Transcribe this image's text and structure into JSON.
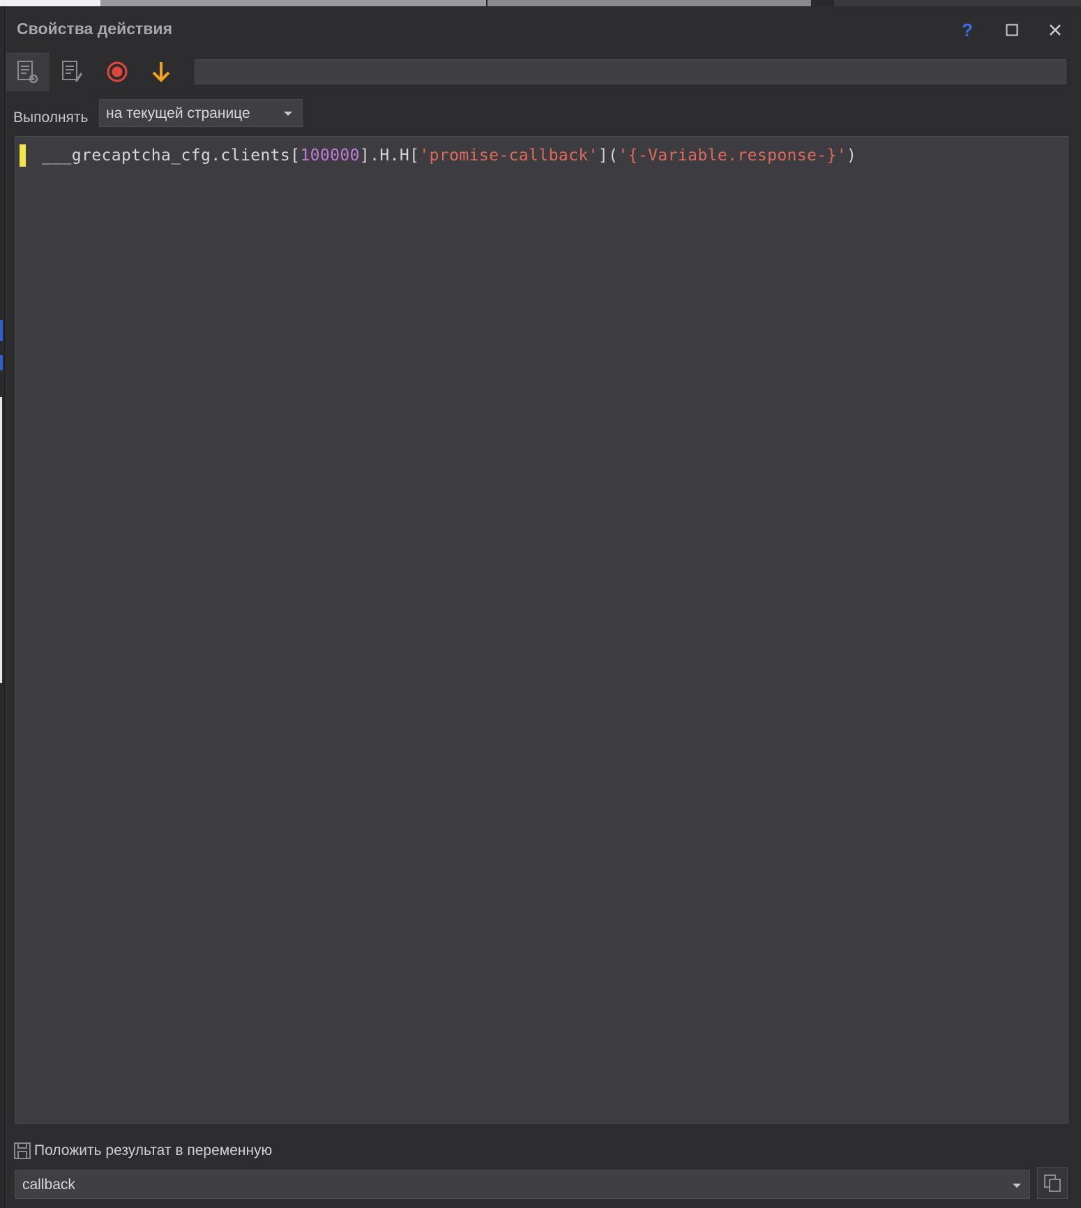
{
  "window": {
    "title": "Свойства действия"
  },
  "toolbar": {
    "buttons": [
      {
        "icon": "list-gear-icon",
        "active": true
      },
      {
        "icon": "list-edit-icon",
        "active": false
      },
      {
        "icon": "record-icon",
        "color": "#e0473c"
      },
      {
        "icon": "arrow-down-icon",
        "color": "#f2a316"
      }
    ],
    "input_value": ""
  },
  "execute": {
    "label": "Выполнять",
    "selected": "на текущей странице"
  },
  "editor": {
    "code_tokens": [
      {
        "type": "plain",
        "text": "___grecaptcha_cfg.clients["
      },
      {
        "type": "num",
        "text": "100000"
      },
      {
        "type": "plain",
        "text": "].H.H["
      },
      {
        "type": "str",
        "text": "'promise-callback'"
      },
      {
        "type": "plain",
        "text": "]("
      },
      {
        "type": "str",
        "text": "'{-Variable.response-}'"
      },
      {
        "type": "plain",
        "text": ")"
      }
    ]
  },
  "result": {
    "label": "Положить результат в переменную",
    "variable": "callback"
  },
  "colors": {
    "accent_blue": "#3d6fe0",
    "marker_yellow": "#f5e34a",
    "string_red": "#e06a5a",
    "number_purple": "#c27bd6"
  }
}
